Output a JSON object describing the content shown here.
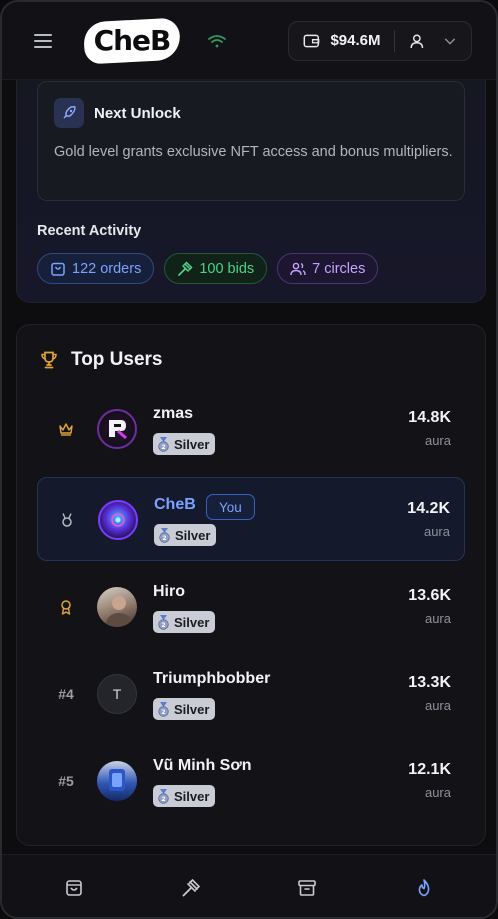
{
  "header": {
    "logo": "CheB",
    "menu_icon": "hamburger-menu-icon",
    "wallet_amount": "$94.6M"
  },
  "next_unlock": {
    "title": "Next Unlock",
    "description": "Gold level grants exclusive NFT access and bonus multipliers."
  },
  "recent_activity": {
    "title": "Recent Activity",
    "chips": [
      {
        "label": "122 orders",
        "icon": "shopping-bag-icon",
        "color": "#7aa2ff"
      },
      {
        "label": "100 bids",
        "icon": "gavel-icon",
        "color": "#4fd189"
      },
      {
        "label": "7 circles",
        "icon": "users-icon",
        "color": "#c6a2ff"
      }
    ]
  },
  "top_users": {
    "title": "Top Users",
    "icon": "trophy-icon",
    "you_label": "You",
    "rows": [
      {
        "rank": "",
        "rank_icon": "crown-icon",
        "name": "zmas",
        "tier": "Silver",
        "score": "14.8K",
        "unit": "aura"
      },
      {
        "rank": "",
        "rank_icon": "medal-icon",
        "name": "CheB",
        "tier": "Silver",
        "score": "14.2K",
        "unit": "aura",
        "is_me": true
      },
      {
        "rank": "",
        "rank_icon": "award-icon",
        "name": "Hiro",
        "tier": "Silver",
        "score": "13.6K",
        "unit": "aura"
      },
      {
        "rank": "#4",
        "avatar_letter": "T",
        "name": "Triumphbobber",
        "tier": "Silver",
        "score": "13.3K",
        "unit": "aura"
      },
      {
        "rank": "#5",
        "name": "Vũ Minh Sơn",
        "tier": "Silver",
        "score": "12.1K",
        "unit": "aura"
      }
    ]
  },
  "bottom_nav": {
    "items": [
      {
        "icon": "shopping-bag-icon",
        "active": false
      },
      {
        "icon": "gavel-icon",
        "active": false
      },
      {
        "icon": "archive-icon",
        "active": false
      },
      {
        "icon": "flame-icon",
        "active": true
      }
    ]
  },
  "colors": {
    "accent": "#7aa2ff",
    "gold": "#e0a43a",
    "green": "#4fd189",
    "purple": "#c6a2ff"
  }
}
